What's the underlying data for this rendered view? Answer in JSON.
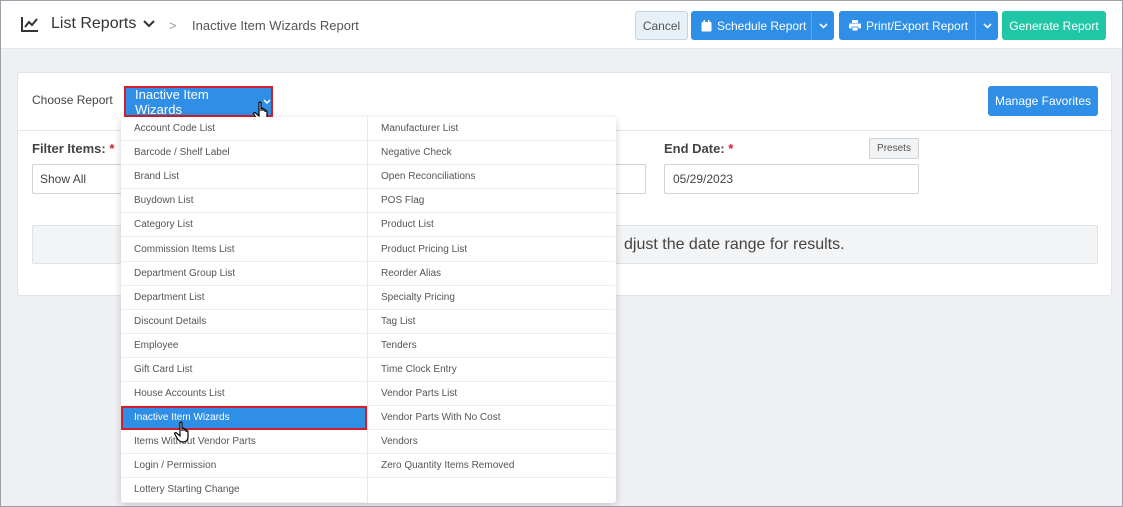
{
  "header": {
    "title": "List Reports",
    "breadcrumb": "Inactive Item Wizards Report",
    "cancel_label": "Cancel",
    "schedule_label": "Schedule Report",
    "print_label": "Print/Export Report",
    "generate_label": "Generate Report"
  },
  "report": {
    "choose_label": "Choose Report",
    "selected": "Inactive Item Wizards",
    "manage_favorites": "Manage Favorites"
  },
  "filters": {
    "filter_label": "Filter Items:",
    "filter_value": "Show All",
    "end_label": "End Date:",
    "required_mark": "*",
    "presets_label": "Presets",
    "end_value": "05/29/2023"
  },
  "message": "djust the date range for results.",
  "dropdown": {
    "left": [
      "Account Code List",
      "Barcode / Shelf Label",
      "Brand List",
      "Buydown List",
      "Category List",
      "Commission Items List",
      "Department Group List",
      "Department List",
      "Discount Details",
      "Employee",
      "Gift Card List",
      "House Accounts List",
      "Inactive Item Wizards",
      "Items Without Vendor Parts",
      "Login / Permission",
      "Lottery Starting Change"
    ],
    "right": [
      "Manufacturer List",
      "Negative Check",
      "Open Reconciliations",
      "POS Flag",
      "Product List",
      "Product Pricing List",
      "Reorder Alias",
      "Specialty Pricing",
      "Tag List",
      "Tenders",
      "Time Clock Entry",
      "Vendor Parts List",
      "Vendor Parts With No Cost",
      "Vendors",
      "Zero Quantity Items Removed"
    ],
    "active_index": 12
  },
  "icons": {
    "title_icon": "line-chart-icon",
    "calendar": "calendar-icon",
    "printer": "printer-icon",
    "chevron": "chevron-down-icon",
    "cursor": "hand-pointer-icon"
  },
  "colors": {
    "primary": "#2f8ee5",
    "success": "#1fc7a7",
    "highlight_border": "#d0202a"
  }
}
